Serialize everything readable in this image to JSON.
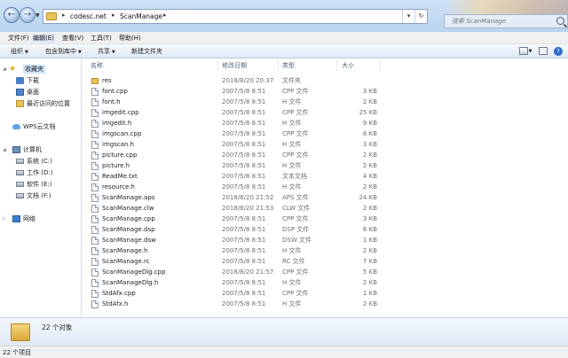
{
  "address": {
    "crumbs": [
      "codesc.net",
      "ScanManage"
    ],
    "search_placeholder": "搜索 ScanManage"
  },
  "menu": [
    "文件(F)",
    "编辑(E)",
    "查看(V)",
    "工具(T)",
    "帮助(H)"
  ],
  "commands": {
    "organize": "组织",
    "include_in_library": "包含到库中",
    "share": "共享",
    "new_folder": "新建文件夹"
  },
  "nav": {
    "favorites": "收藏夹",
    "downloads": "下载",
    "desktop": "桌面",
    "recent": "最近访问的位置",
    "wps": "WPS云文档",
    "computer": "计算机",
    "drive_c": "系统 (C:)",
    "drive_d": "工作 (D:)",
    "drive_e": "软件 (E:)",
    "drive_f": "文档 (F:)",
    "network": "网络"
  },
  "columns": {
    "name": "名称",
    "date": "修改日期",
    "type": "类型",
    "size": "大小"
  },
  "files": [
    {
      "name": "res",
      "date": "2018/8/20 20:37",
      "type": "文件夹",
      "size": ""
    },
    {
      "name": "font.cpp",
      "date": "2007/5/8 8:51",
      "type": "CPP 文件",
      "size": "3 KB"
    },
    {
      "name": "font.h",
      "date": "2007/5/8 8:51",
      "type": "H 文件",
      "size": "2 KB"
    },
    {
      "name": "imgedit.cpp",
      "date": "2007/5/8 8:51",
      "type": "CPP 文件",
      "size": "25 KB"
    },
    {
      "name": "imgedit.h",
      "date": "2007/5/8 8:51",
      "type": "H 文件",
      "size": "9 KB"
    },
    {
      "name": "imgscan.cpp",
      "date": "2007/5/8 8:51",
      "type": "CPP 文件",
      "size": "6 KB"
    },
    {
      "name": "imgscan.h",
      "date": "2007/5/8 8:51",
      "type": "H 文件",
      "size": "3 KB"
    },
    {
      "name": "picture.cpp",
      "date": "2007/5/8 8:51",
      "type": "CPP 文件",
      "size": "2 KB"
    },
    {
      "name": "picture.h",
      "date": "2007/5/8 8:51",
      "type": "H 文件",
      "size": "2 KB"
    },
    {
      "name": "ReadMe.txt",
      "date": "2007/5/8 8:51",
      "type": "文本文档",
      "size": "4 KB"
    },
    {
      "name": "resource.h",
      "date": "2007/5/8 8:51",
      "type": "H 文件",
      "size": "2 KB"
    },
    {
      "name": "ScanManage.aps",
      "date": "2018/8/20 21:52",
      "type": "APS 文件",
      "size": "24 KB"
    },
    {
      "name": "ScanManage.clw",
      "date": "2018/8/20 21:53",
      "type": "CLW 文件",
      "size": "2 KB"
    },
    {
      "name": "ScanManage.cpp",
      "date": "2007/5/8 8:51",
      "type": "CPP 文件",
      "size": "3 KB"
    },
    {
      "name": "ScanManage.dsp",
      "date": "2007/5/8 8:51",
      "type": "DSP 文件",
      "size": "6 KB"
    },
    {
      "name": "ScanManage.dsw",
      "date": "2007/5/8 8:51",
      "type": "DSW 文件",
      "size": "1 KB"
    },
    {
      "name": "ScanManage.h",
      "date": "2007/5/8 8:51",
      "type": "H 文件",
      "size": "2 KB"
    },
    {
      "name": "ScanManage.rc",
      "date": "2007/5/8 8:51",
      "type": "RC 文件",
      "size": "7 KB"
    },
    {
      "name": "ScanManageDlg.cpp",
      "date": "2018/8/20 21:57",
      "type": "CPP 文件",
      "size": "5 KB"
    },
    {
      "name": "ScanManageDlg.h",
      "date": "2007/5/8 8:51",
      "type": "H 文件",
      "size": "2 KB"
    },
    {
      "name": "StdAfx.cpp",
      "date": "2007/5/8 8:51",
      "type": "CPP 文件",
      "size": "1 KB"
    },
    {
      "name": "StdAfx.h",
      "date": "2007/5/8 8:51",
      "type": "H 文件",
      "size": "2 KB"
    }
  ],
  "details_text": "22 个对象",
  "status_text": "22 个项目"
}
